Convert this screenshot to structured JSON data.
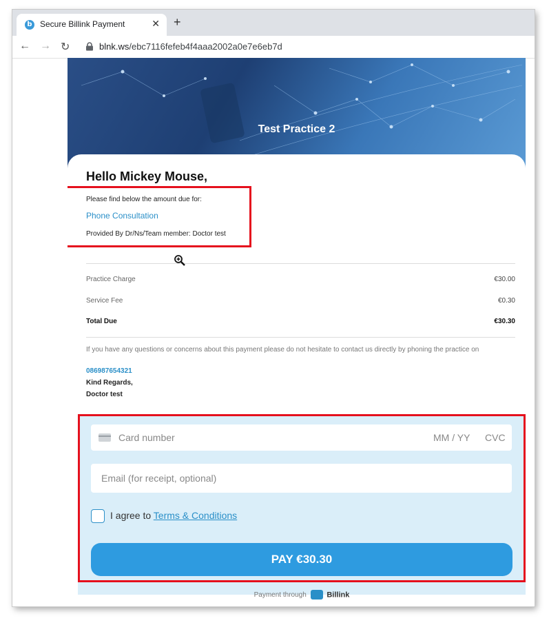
{
  "browser": {
    "tab_title": "Secure Billink Payment",
    "tab_favicon": "billink-logo-icon",
    "url_host": "blnk.ws",
    "url_path": "/ebc7116fefeb4f4aaa2002a0e7e6eb7d",
    "new_tab_glyph": "+",
    "close_glyph": "✕"
  },
  "hero": {
    "title": "Test Practice 2"
  },
  "greeting": {
    "hello": "Hello Mickey Mouse,",
    "intro": "Please find below the amount due for:",
    "service": "Phone Consultation",
    "provider": "Provided By Dr/Ns/Team member: Doctor test"
  },
  "charges": [
    {
      "label": "Practice Charge",
      "value": "€30.00"
    },
    {
      "label": "Service Fee",
      "value": "€0.30"
    },
    {
      "label": "Total Due",
      "value": "€30.30"
    }
  ],
  "contact": {
    "note": "If you have any questions or concerns about this payment please do not hesitate to contact us directly by phoning the practice on",
    "phone": "086987654321",
    "regards": "Kind Regards,",
    "signer": "Doctor test"
  },
  "payment": {
    "card_placeholder": "Card number",
    "expiry_placeholder": "MM / YY",
    "cvc_placeholder": "CVC",
    "email_placeholder": "Email (for receipt, optional)",
    "agree_prefix": "I agree to",
    "terms_link": "Terms & Conditions",
    "pay_button": "PAY €30.30"
  },
  "footer": {
    "payment_through": "Payment through",
    "brand": "Billink"
  },
  "colors": {
    "accent": "#2e9be0",
    "highlight": "#e5101d",
    "pay_area": "#daeef9"
  }
}
